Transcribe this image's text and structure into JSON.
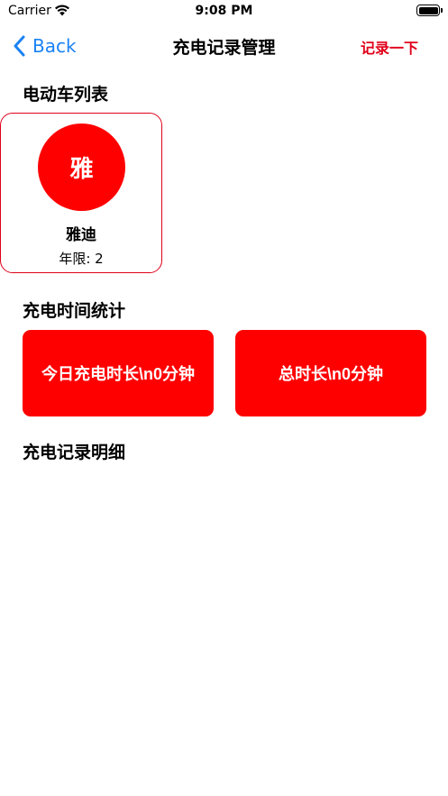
{
  "status_bar": {
    "carrier": "Carrier",
    "time": "9:08 PM"
  },
  "nav": {
    "back_label": "Back",
    "title": "充电记录管理",
    "action_label": "记录一下"
  },
  "vehicles": {
    "section_title": "电动车列表",
    "items": [
      {
        "avatar_char": "雅",
        "name": "雅迪",
        "years": "年限: 2"
      }
    ]
  },
  "stats": {
    "section_title": "充电时间统计",
    "today_label": "今日充电时长\\n0分钟",
    "total_label": "总时长\\n0分钟"
  },
  "details": {
    "section_title": "充电记录明细",
    "records": []
  },
  "colors": {
    "accent_red": "#ff0000",
    "nav_action_red": "#e0001a",
    "ios_blue": "#1a82f5"
  }
}
